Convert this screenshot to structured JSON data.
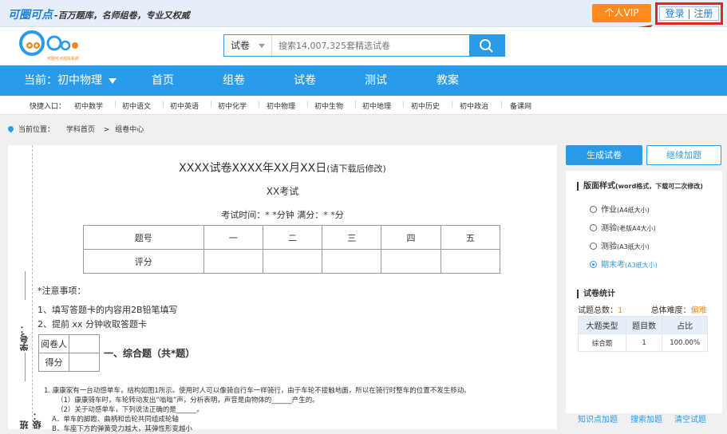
{
  "topbar": {
    "brand": "可圈可点",
    "slogan": "-百万题库，名师组卷，专业又权威",
    "vip_button": "个人VIP",
    "login": "登录",
    "separator": "|",
    "register": "注册"
  },
  "header": {
    "logo_sub": "可圈可点题库系统",
    "search_type": "试卷",
    "search_placeholder": "搜索14,007,325套精选试卷"
  },
  "nav": {
    "current": "当前：初中物理",
    "items": [
      "首页",
      "组卷",
      "试卷",
      "测试",
      "教案"
    ]
  },
  "quick": {
    "label": "快捷入口：",
    "items": [
      "初中数学",
      "初中语文",
      "初中英语",
      "初中化学",
      "初中物理",
      "初中生物",
      "初中地理",
      "初中历史",
      "初中政治",
      "备课网"
    ]
  },
  "breadcrumb": {
    "label": "当前位置：",
    "home": "学科首页",
    "arrow": ">",
    "current": "组卷中心"
  },
  "paper": {
    "title": "XXXX试卷XXXX年XX月XX日",
    "title_note": "(请下载后修改)",
    "subtitle": "XX考试",
    "time_line": "考试时间：* *分钟    满分：* *分",
    "score_table": {
      "header": [
        "题号",
        "一",
        "二",
        "三",
        "四",
        "五"
      ],
      "row_label": "评分"
    },
    "notice_title": "*注意事项：",
    "notice_items": [
      "1、填写答题卡的内容用2B铅笔填写",
      "2、提前 xx 分钟收取答题卡"
    ],
    "reviewer": "阅卷人",
    "score": "得分",
    "section_title": "一、综合题（共*题）",
    "question_lines": [
      "1.  康康家有一台动感单车，结构如图1所示。使用时人可以像骑自行车一样骑行，由于车轮不接触地面，所以在骑行时整车的位置不发生移动。",
      "（1）康康骑车时，车轮转动发出“嗡嗡”声，分析表明，声音是由物体的______产生的。",
      "（2）关于动感单车，下列说法正确的是______。",
      "A．单车的脚蹬、曲柄和齿轮共同组成轮轴",
      "B．车座下方的弹簧受力越大，其弹性形变越小"
    ],
    "side_labels": [
      "学号：",
      "班级："
    ]
  },
  "panel": {
    "generate_button": "生成试卷",
    "continue_button": "继续加题",
    "layout_title": "版面样式",
    "layout_note": "(word格式，下载可二次修改)",
    "layout_options": [
      {
        "label": "作业",
        "note": "(A4纸大小)"
      },
      {
        "label": "测验",
        "note": "(老版A4大小)"
      },
      {
        "label": "测验",
        "note": "(A3纸大小)"
      },
      {
        "label": "期末考",
        "note": "(A3纸大小)"
      }
    ],
    "stats_title": "试卷统计",
    "total_label": "试题总数：",
    "total_value": "1",
    "difficulty_label": "总体难度：",
    "difficulty_value": "偏难",
    "types_table": {
      "header": [
        "大题类型",
        "题目数",
        "占比"
      ],
      "rows": [
        [
          "综合题",
          "1",
          "100.00%"
        ]
      ]
    },
    "links": [
      "知识点加题",
      "搜索加题",
      "清空试题"
    ]
  },
  "colors": {
    "primary": "#2a9bea",
    "accent": "#ff8a1f",
    "highlight_border": "#e8232a"
  }
}
